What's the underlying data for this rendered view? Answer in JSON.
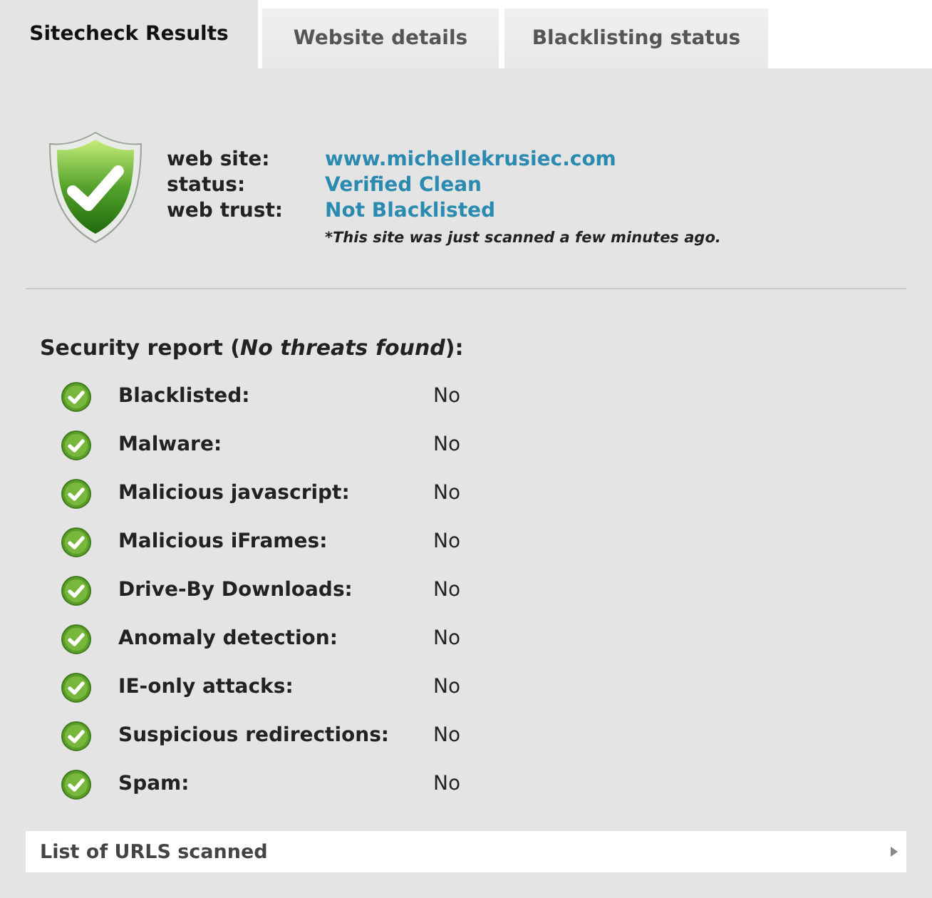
{
  "tabs": [
    {
      "label": "Sitecheck Results",
      "selected": true
    },
    {
      "label": "Website details",
      "selected": false
    },
    {
      "label": "Blacklisting status",
      "selected": false
    }
  ],
  "summary": {
    "fields": [
      {
        "label": "web site:",
        "value": "www.michellekrusiec.com"
      },
      {
        "label": "status:",
        "value": "Verified Clean"
      },
      {
        "label": "web trust:",
        "value": "Not Blacklisted"
      }
    ],
    "note": "*This site was just scanned a few minutes ago."
  },
  "security_report": {
    "heading": "Security report (*No threats found*):",
    "items": [
      {
        "label": "Blacklisted:",
        "value": "No",
        "passed": true
      },
      {
        "label": "Malware:",
        "value": "No",
        "passed": true
      },
      {
        "label": "Malicious javascript:",
        "value": "No",
        "passed": true
      },
      {
        "label": "Malicious iFrames:",
        "value": "No",
        "passed": true
      },
      {
        "label": "Drive-By Downloads:",
        "value": "No",
        "passed": true
      },
      {
        "label": "Anomaly detection:",
        "value": "No",
        "passed": true
      },
      {
        "label": "IE-only attacks:",
        "value": "No",
        "passed": true
      },
      {
        "label": "Suspicious redirections:",
        "value": "No",
        "passed": true
      },
      {
        "label": "Spam:",
        "value": "No",
        "passed": true
      }
    ]
  },
  "urls_panel": {
    "label": "List of URLS scanned",
    "expanded": false
  }
}
